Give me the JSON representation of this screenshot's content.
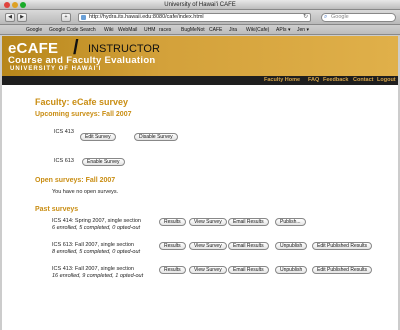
{
  "window": {
    "title": "University of Hawai'i CAFE"
  },
  "toolbar": {
    "back_glyph": "◀",
    "forward_glyph": "▶",
    "plus_glyph": "+",
    "url": "http://hydra.its.hawaii.edu:8080/cafe/index.html",
    "reload_glyph": "↻",
    "search_placeholder": "Google",
    "search_glyph": "⌕"
  },
  "bookmarks": [
    "Google",
    "Google Code Search",
    "Wiki",
    "WebMail",
    "UHM",
    "races",
    "BugMeNot",
    "CAFE",
    "Jira",
    "Wiki(Cafe)",
    "APIs ▾",
    "Jen ▾"
  ],
  "banner": {
    "logo_main": "eCAFE",
    "logo_slash": "/",
    "logo_instructor": "INSTRUCTOR",
    "logo_course": "Course and Faculty Evaluation",
    "logo_university": "UNIVERSITY OF HAWAI'I"
  },
  "nav": {
    "faculty_home": "Faculty Home",
    "faq": "FAQ",
    "feedback": "Feedback",
    "contact": "Contact",
    "logout": "Logout"
  },
  "main": {
    "title": "Faculty: eCafe survey",
    "upcoming_heading": "Upcoming surveys: Fall 2007",
    "upcoming": [
      {
        "course": "ICS 413",
        "buttons": [
          "Edit Survey",
          "Disable Survey"
        ]
      },
      {
        "course": "ICS 613",
        "buttons": [
          "Enable Survey"
        ]
      }
    ],
    "open_heading": "Open surveys: Fall 2007",
    "open_empty": "You have no open surveys.",
    "past_heading": "Past surveys",
    "past": [
      {
        "line1": "ICS 414: Spring 2007, single section",
        "line2": "6 enrolled, 5 completed, 0 opted-out",
        "buttons": [
          "Results",
          "View Survey",
          "Email Results",
          "Publish..."
        ]
      },
      {
        "line1": "ICS 613: Fall 2007, single section",
        "line2": "8 enrolled, 5 completed, 0 opted-out",
        "buttons": [
          "Results",
          "View Survey",
          "Email Results",
          "Unpublish",
          "Edit Published Results"
        ]
      },
      {
        "line1": "ICS 413: Fall 2007, single section",
        "line2": "16 enrolled, 9 completed, 1 opted-out",
        "buttons": [
          "Results",
          "View Survey",
          "Email Results",
          "Unpublish",
          "Edit Published Results"
        ]
      }
    ]
  }
}
